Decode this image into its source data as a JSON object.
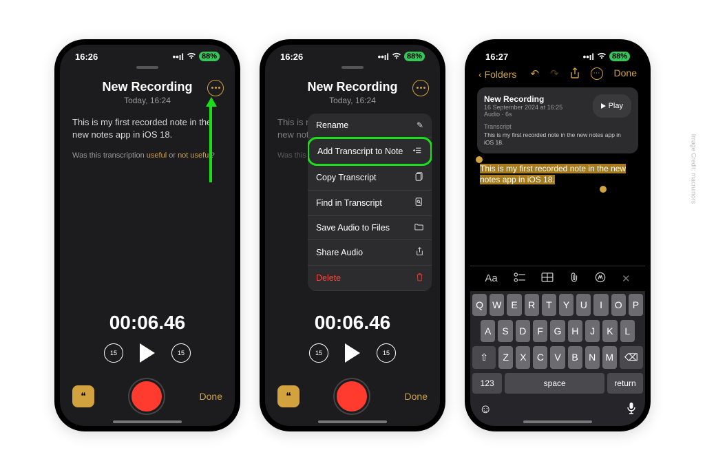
{
  "phones": [
    {
      "time": "16:26",
      "battery": "88%"
    },
    {
      "time": "16:26",
      "battery": "88%"
    },
    {
      "time": "16:27",
      "battery": "88%"
    }
  ],
  "rec": {
    "title": "New Recording",
    "subtitle": "Today, 16:24",
    "text": "This is my first recorded note in the new notes app in iOS 18.",
    "feedback_pre": "Was this transcription ",
    "feedback_useful": "useful",
    "feedback_or": " or ",
    "feedback_not": "not useful",
    "feedback_q": "?",
    "timer": "00:06.46",
    "done": "Done"
  },
  "menu": {
    "rename": "Rename",
    "add": "Add Transcript to Note",
    "copy": "Copy Transcript",
    "find": "Find in Transcript",
    "save": "Save Audio to Files",
    "share": "Share Audio",
    "delete": "Delete"
  },
  "note": {
    "back": "Folders",
    "done": "Done",
    "card_title": "New Recording",
    "card_sub": "16 September 2024 at 16:25",
    "card_sub2": "Audio · 6s",
    "play": "Play",
    "transcript": "Transcript",
    "card_text": "This is my first recorded note in the new notes app in iOS 18.",
    "selected": "This is my first recorded note in the new notes app in iOS 18."
  },
  "kbd": {
    "space": "space",
    "return": "return",
    "num": "123",
    "r1": [
      "Q",
      "W",
      "E",
      "R",
      "T",
      "Y",
      "U",
      "I",
      "O",
      "P"
    ],
    "r2": [
      "A",
      "S",
      "D",
      "F",
      "G",
      "H",
      "J",
      "K",
      "L"
    ],
    "r3": [
      "Z",
      "X",
      "C",
      "V",
      "B",
      "N",
      "M"
    ]
  },
  "credit": "Image Credit: macrumors"
}
